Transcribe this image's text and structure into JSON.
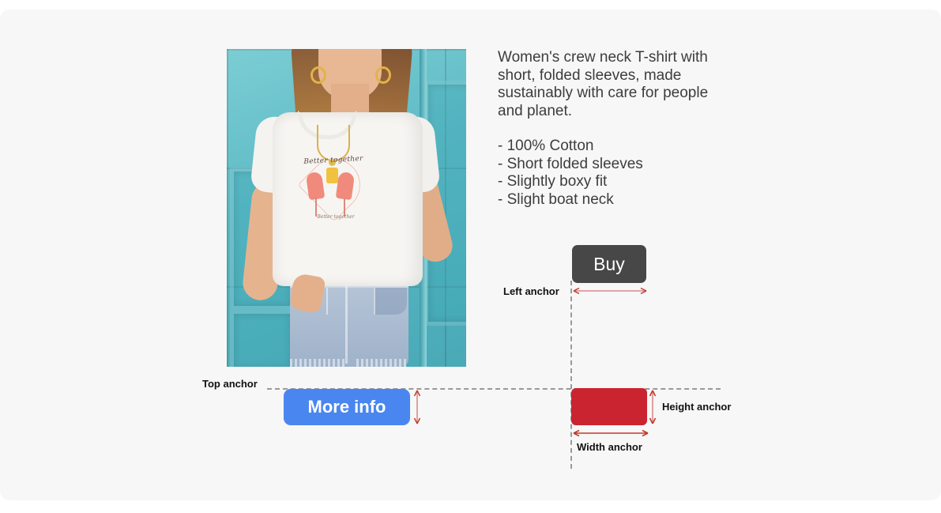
{
  "page": {
    "background": "#ffffff",
    "panel_background": "#f7f7f7"
  },
  "product": {
    "photo_alt": "woman-wearing-white-flamingo-tshirt-and-denim-shorts",
    "graphic_text": "Better together",
    "graphic_subtext": "Better together"
  },
  "description": {
    "intro": "Women's crew neck T-shirt with short, folded sleeves, made sustainably with care for people and planet.",
    "features": [
      "- 100% Cotton",
      "- Short folded sleeves",
      "- Slightly boxy fit",
      "- Slight boat neck"
    ]
  },
  "controls": {
    "buy_label": "Buy",
    "buy_color": "#474747",
    "more_info_label": "More info",
    "more_info_color": "#4a86f0",
    "red_box_color": "#ca2430"
  },
  "annotations": {
    "top_anchor": "Top anchor",
    "left_anchor": "Left anchor",
    "height_anchor": "Height anchor",
    "width_anchor": "Width anchor",
    "guide_color": "#9a9a9a",
    "arrow_color_light": "#d98a8a",
    "arrow_color_dark": "#c0392b"
  }
}
